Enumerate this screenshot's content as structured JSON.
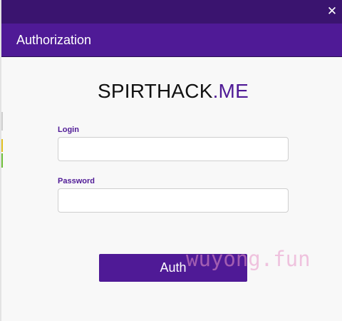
{
  "window": {
    "close_glyph": "✕"
  },
  "header": {
    "title": "Authorization"
  },
  "brand": {
    "name_main": "SPIRTHACK",
    "name_accent": ".ME",
    "accent_color": "#4f1a96"
  },
  "form": {
    "login": {
      "label": "Login",
      "value": "",
      "placeholder": ""
    },
    "password": {
      "label": "Password",
      "value": "",
      "placeholder": ""
    },
    "submit_label": "Auth"
  },
  "watermark": {
    "text": "wuyong.fun"
  },
  "colors": {
    "titlebar": "#3a146f",
    "header": "#4f1a96",
    "background": "#f8f8f8",
    "button": "#4f1a96"
  }
}
